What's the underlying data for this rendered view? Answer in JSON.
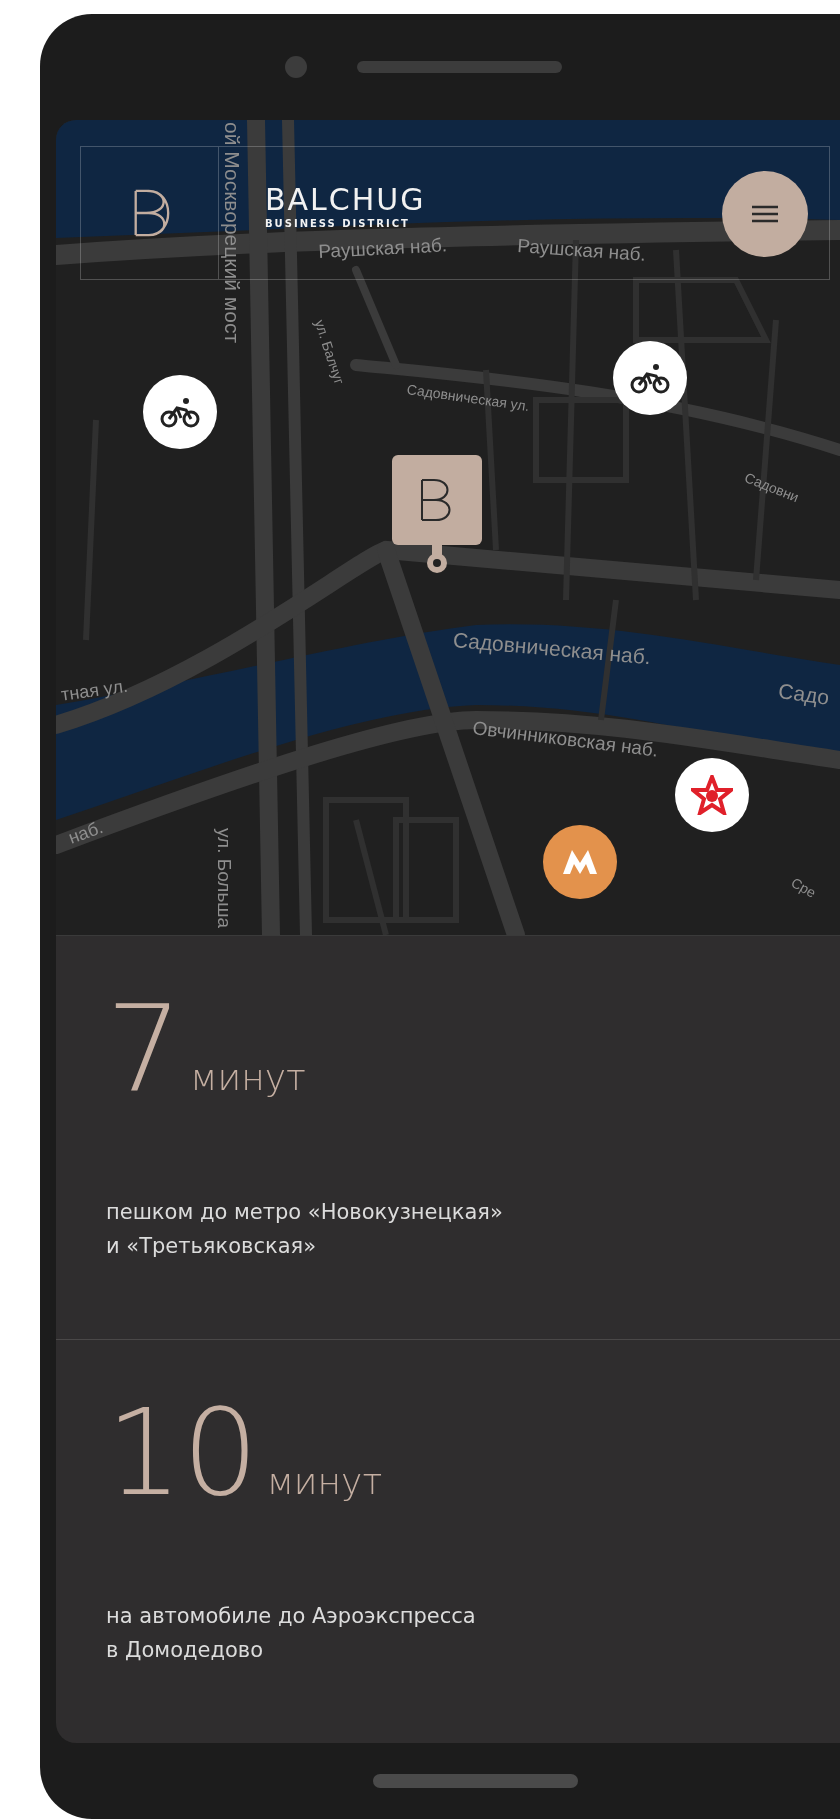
{
  "header": {
    "brand": "BALCHUG",
    "tagline": "BUSINESS DISTRICT"
  },
  "map": {
    "labels": [
      {
        "text": "ой Москворецкий мост"
      },
      {
        "text": "Раушская наб."
      },
      {
        "text": "Раушская наб."
      },
      {
        "text": "ул. Балчуг"
      },
      {
        "text": "Садовническая ул."
      },
      {
        "text": "Садовни"
      },
      {
        "text": "Садовническая наб."
      },
      {
        "text": "Садо"
      },
      {
        "text": "тная ул."
      },
      {
        "text": "Овчинниковская наб."
      },
      {
        "text": "наб."
      },
      {
        "text": "ул. Больша"
      },
      {
        "text": "Сре"
      }
    ],
    "markers": [
      {
        "kind": "bike"
      },
      {
        "kind": "bike"
      },
      {
        "kind": "office"
      },
      {
        "kind": "star"
      },
      {
        "kind": "metro"
      }
    ]
  },
  "stats": [
    {
      "value": "7",
      "unit": "минут",
      "text": "пешком до метро «Новокузнецкая»\nи «Третьяковская»"
    },
    {
      "value": "10",
      "unit": "минут",
      "text": "на автомобиле до Аэроэкспресса\nв Домодедово"
    }
  ]
}
